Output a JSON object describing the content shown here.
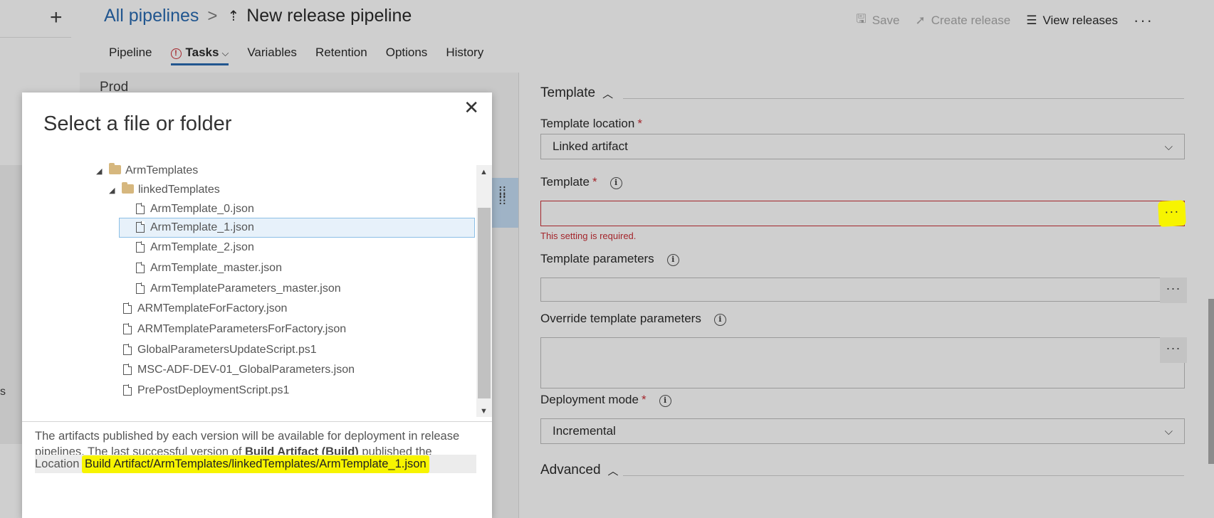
{
  "rail": {
    "add_icon": "plus-icon",
    "partial_text": "s"
  },
  "breadcrumb": {
    "root": "All pipelines",
    "separator": ">",
    "pipeline_icon": "pipeline-icon",
    "title": "New release pipeline"
  },
  "actions": {
    "save": "Save",
    "create_release": "Create release",
    "view_releases": "View releases",
    "more": "···"
  },
  "tabs": [
    {
      "label": "Pipeline"
    },
    {
      "label": "Tasks",
      "active": true,
      "warning": true
    },
    {
      "label": "Variables"
    },
    {
      "label": "Retention"
    },
    {
      "label": "Options"
    },
    {
      "label": "History"
    }
  ],
  "stage": {
    "name": "Prod"
  },
  "panel": {
    "template_section": "Template",
    "template_location_label": "Template location",
    "template_location_value": "Linked artifact",
    "template_label": "Template",
    "template_value": "",
    "template_error": "This setting is required.",
    "template_parameters_label": "Template parameters",
    "override_label": "Override template parameters",
    "deployment_mode_label": "Deployment mode",
    "deployment_mode_value": "Incremental",
    "advanced_section": "Advanced",
    "required_mark": "*",
    "browse_button": "···"
  },
  "dialog": {
    "title": "Select a file or folder",
    "close": "✕",
    "tree": [
      {
        "label": "ArmTemplates",
        "kind": "folder",
        "expanded": true
      },
      {
        "label": "linkedTemplates",
        "kind": "folder",
        "expanded": true
      },
      {
        "label": "ArmTemplate_0.json",
        "kind": "file"
      },
      {
        "label": "ArmTemplate_1.json",
        "kind": "file",
        "selected": true
      },
      {
        "label": "ArmTemplate_2.json",
        "kind": "file"
      },
      {
        "label": "ArmTemplate_master.json",
        "kind": "file"
      },
      {
        "label": "ArmTemplateParameters_master.json",
        "kind": "file"
      },
      {
        "label": "ARMTemplateForFactory.json",
        "kind": "file"
      },
      {
        "label": "ARMTemplateParametersForFactory.json",
        "kind": "file"
      },
      {
        "label": "GlobalParametersUpdateScript.ps1",
        "kind": "file"
      },
      {
        "label": "MSC-ADF-DEV-01_GlobalParameters.json",
        "kind": "file"
      },
      {
        "label": "PrePostDeploymentScript.ps1",
        "kind": "file"
      }
    ],
    "info_text_1": "The artifacts published by each version will be available for deployment in release pipelines. The last successful version of ",
    "info_artifact": "Build Artifact (Build)",
    "info_text_2": " published the following",
    "location_label": "Location",
    "location_value": "Build Artifact/ArmTemplates/linkedTemplates/ArmTemplate_1.json"
  },
  "colors": {
    "accent": "#21568f",
    "error": "#a4262c",
    "highlight": "#f7f400",
    "selected_row": "#e7f1fa"
  }
}
